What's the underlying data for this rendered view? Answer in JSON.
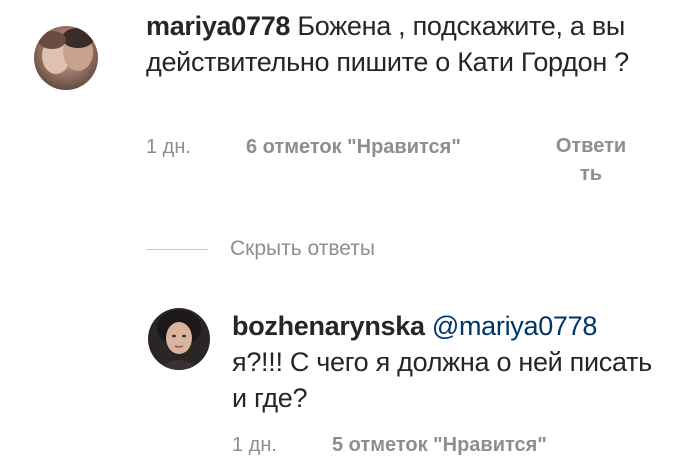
{
  "comment": {
    "username": "mariya0778",
    "text": "Божена , подскажите, а вы действительно пишите о Кати Гордон ?",
    "time": "1 дн.",
    "likes": "6 отметок \"Нравится\"",
    "reply_label_line1": "Ответи",
    "reply_label_line2": "ть"
  },
  "hide_replies": {
    "label": "Скрыть ответы"
  },
  "reply": {
    "username": "bozhenarynska",
    "mention": "@mariya0778",
    "text": "я?!!! С чего я должна о ней писать и где?",
    "time": "1 дн.",
    "likes": "5 отметок \"Нравится\""
  }
}
